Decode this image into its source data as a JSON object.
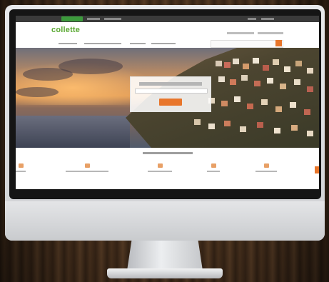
{
  "website": {
    "logo_text": "collette",
    "colors": {
      "brand_green": "#5aa832",
      "accent_orange": "#e8762b"
    }
  },
  "icons": [
    "monitor-icon"
  ]
}
